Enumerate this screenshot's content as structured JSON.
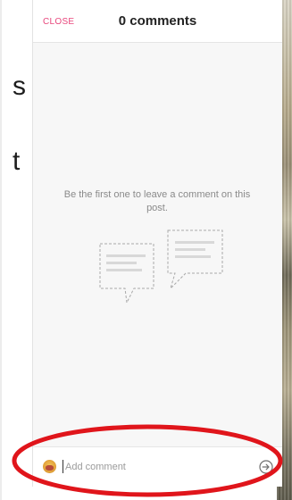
{
  "background": {
    "left_chars": [
      "s",
      "t"
    ]
  },
  "header": {
    "close_label": "CLOSE",
    "title": "0 comments"
  },
  "empty_state": {
    "message": "Be the first one to leave a comment on this post.",
    "illustration_icon": "speech-bubbles-icon"
  },
  "footer": {
    "avatar_icon": "user-avatar",
    "placeholder": "Add comment",
    "send_icon": "send-arrow-icon"
  },
  "colors": {
    "accent": "#e8467c",
    "annotation": "#e0151b"
  }
}
